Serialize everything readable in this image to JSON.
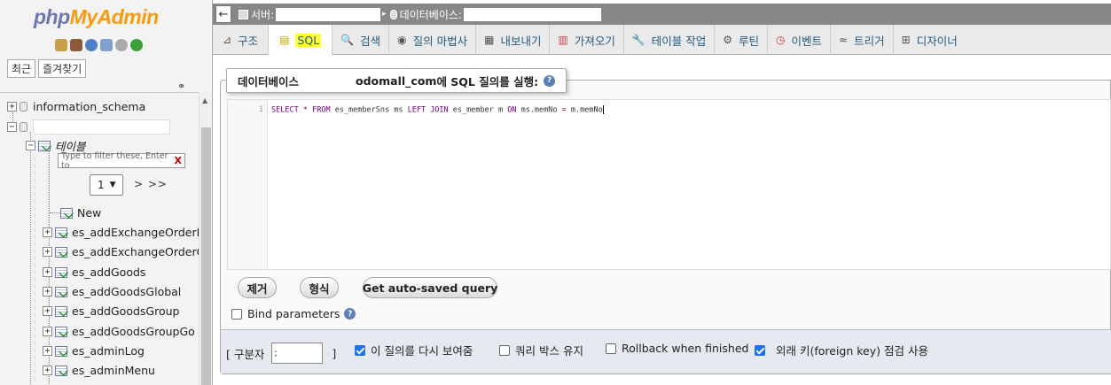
{
  "nav": {
    "logo_php": "php",
    "logo_myadmin": "MyAdmin",
    "tab_recent": "최근",
    "tab_favorites": "즐겨찾기",
    "tree": {
      "information_schema": "information_schema",
      "tables_label": "테이블",
      "filter_placeholder": "Type to filter these, Enter to",
      "filter_clear": "X",
      "page_value": "1",
      "page_next": "> >>",
      "new_label": "New",
      "tables": [
        "es_addExchangeOrderI",
        "es_addExchangeOrderG",
        "es_addGoods",
        "es_addGoodsGlobal",
        "es_addGoodsGroup",
        "es_addGoodsGroupGo",
        "es_adminLog",
        "es_adminMenu"
      ]
    }
  },
  "breadcrumb": {
    "back": "←",
    "server_label": "서버:",
    "database_label": "데이터베이스:"
  },
  "tabs": [
    {
      "label": "구조",
      "icon": "structure-icon",
      "glyph": "⊿"
    },
    {
      "label": "SQL",
      "icon": "sql-icon",
      "glyph": "▤"
    },
    {
      "label": "검색",
      "icon": "search-icon",
      "glyph": "🔍"
    },
    {
      "label": "질의 마법사",
      "icon": "query-icon",
      "glyph": "◉"
    },
    {
      "label": "내보내기",
      "icon": "export-icon",
      "glyph": "▦"
    },
    {
      "label": "가져오기",
      "icon": "import-icon",
      "glyph": "▥"
    },
    {
      "label": "테이블 작업",
      "icon": "operations-icon",
      "glyph": "🔧"
    },
    {
      "label": "루틴",
      "icon": "routines-icon",
      "glyph": "⚙"
    },
    {
      "label": "이벤트",
      "icon": "events-icon",
      "glyph": "◷"
    },
    {
      "label": "트리거",
      "icon": "triggers-icon",
      "glyph": "≈"
    },
    {
      "label": "디자이너",
      "icon": "designer-icon",
      "glyph": "⊞"
    }
  ],
  "sql_panel": {
    "legend_prefix": "데이터베이스",
    "legend_db": "odomall_com",
    "legend_suffix": "에 SQL 질의를 실행:",
    "help": "?",
    "line_number": "1",
    "code_prefix": "SELECT * FROM es_memberSns ms LEFT JOIN es_member m ON ms.memNo = m.memNo",
    "buttons": {
      "clear": "제거",
      "format": "형식",
      "autosaved": "Get auto-saved query"
    },
    "bind_parameters": "Bind parameters"
  },
  "options": {
    "delimiter_label": "[ 구분자",
    "delimiter_value": ";",
    "delimiter_close": "]",
    "show_again": "이 질의를 다시 보여줌",
    "keep_box": "쿼리 박스 유지",
    "rollback": "Rollback when finished",
    "fk_check": "외래 키(foreign key) 점검 사용"
  },
  "colors": {
    "logo_php": "#6c78af",
    "logo_myadmin": "#f89c0e",
    "sql_highlight": "#ffff33",
    "checkbox_on": "#1a73e8"
  }
}
